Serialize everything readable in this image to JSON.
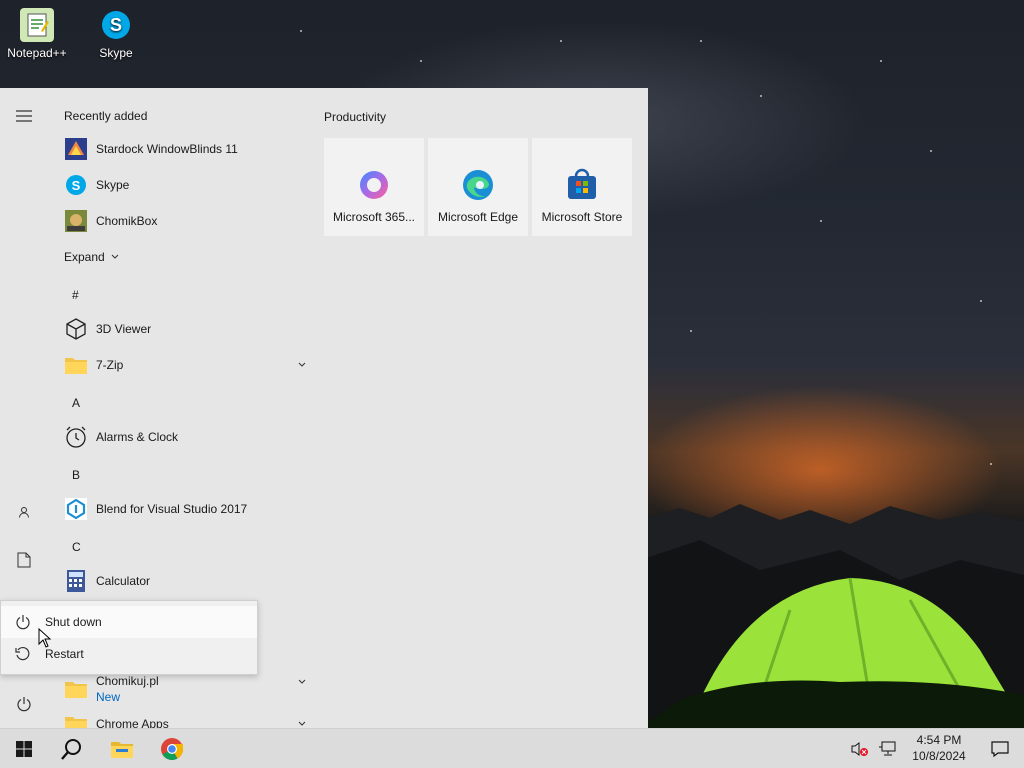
{
  "desktop": {
    "icons": [
      {
        "label": "Notepad++",
        "icon": "notepad-plus-plus-icon"
      },
      {
        "label": "Skype",
        "icon": "skype-icon"
      }
    ]
  },
  "start_menu": {
    "recently_added_title": "Recently added",
    "recent_apps": [
      {
        "label": "Stardock WindowBlinds 11",
        "icon": "windowblinds-icon"
      },
      {
        "label": "Skype",
        "icon": "skype-icon"
      },
      {
        "label": "ChomikBox",
        "icon": "chomikbox-icon"
      }
    ],
    "expand_label": "Expand",
    "groups": [
      {
        "letter": "#",
        "apps": [
          {
            "label": "3D Viewer",
            "icon": "cube-icon"
          },
          {
            "label": "7-Zip",
            "icon": "folder-icon",
            "expandable": true
          }
        ]
      },
      {
        "letter": "A",
        "apps": [
          {
            "label": "Alarms & Clock",
            "icon": "alarm-clock-icon"
          }
        ]
      },
      {
        "letter": "B",
        "apps": [
          {
            "label": "Blend for Visual Studio 2017",
            "icon": "blend-icon"
          }
        ]
      },
      {
        "letter": "C",
        "apps": [
          {
            "label": "Calculator",
            "icon": "calculator-icon"
          },
          {
            "label": "Chomikuj.pl",
            "sublabel": "New",
            "icon": "folder-icon",
            "expandable": true
          },
          {
            "label": "Chrome Apps",
            "icon": "folder-icon",
            "expandable": true
          }
        ]
      }
    ],
    "tiles_group_title": "Productivity",
    "tiles": [
      {
        "label": "Microsoft 365...",
        "icon": "microsoft-365-icon"
      },
      {
        "label": "Microsoft Edge",
        "icon": "edge-icon"
      },
      {
        "label": "Microsoft Store",
        "icon": "store-icon"
      }
    ],
    "power_menu": [
      {
        "label": "Shut down",
        "icon": "power-icon"
      },
      {
        "label": "Restart",
        "icon": "restart-icon"
      }
    ]
  },
  "taskbar": {
    "time": "4:54 PM",
    "date": "10/8/2024"
  },
  "colors": {
    "start_bg": "#e6e6e6",
    "taskbar_bg": "#dcdcdc",
    "accent_blue": "#0078d4",
    "tent_green": "#9be33a"
  }
}
